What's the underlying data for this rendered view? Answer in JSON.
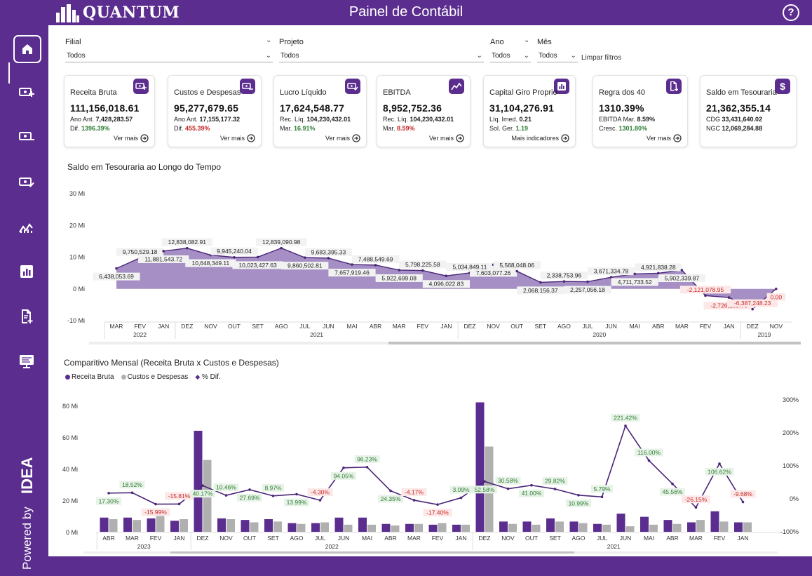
{
  "header": {
    "logo_text": "QUANTUM",
    "title": "Painel de Contábil",
    "help_icon": "question-icon"
  },
  "sidebar": {
    "items": [
      {
        "icon": "home-icon",
        "active": true
      },
      {
        "icon": "money-add-icon",
        "active": false
      },
      {
        "icon": "money-remove-icon",
        "active": false
      },
      {
        "icon": "money-check-icon",
        "active": false
      },
      {
        "icon": "trend-icon",
        "active": false
      },
      {
        "icon": "bar-chart-icon",
        "active": false
      },
      {
        "icon": "document-add-icon",
        "active": false
      },
      {
        "icon": "monitor-icon",
        "active": false
      }
    ],
    "powered_by": "Powered by",
    "brand": "IDEA"
  },
  "filters": {
    "filial_label": "Filial",
    "filial_value": "Todos",
    "projeto_label": "Projeto",
    "projeto_value": "Todos",
    "ano_label": "Ano",
    "ano_value": "Todos",
    "mes_label": "Mês",
    "mes_value": "Todos",
    "clear_label": "Limpar filtros"
  },
  "cards": [
    {
      "title": "Receita Bruta",
      "value": "111,156,018.61",
      "l1_label": "Ano Ant.",
      "l1_value": "7,428,283.57",
      "l2_label": "Dif.",
      "l2_value": "1396.39%",
      "l2_tone": "pos",
      "more": "Ver mais",
      "icon": "money-add-icon"
    },
    {
      "title": "Custos e Despesas",
      "value": "95,277,679.65",
      "l1_label": "Ano Ant.",
      "l1_value": "17,155,177.32",
      "l2_label": "Dif.",
      "l2_value": "455.39%",
      "l2_tone": "neg",
      "more": "Ver mais",
      "icon": "money-remove-icon"
    },
    {
      "title": "Lucro Líquido",
      "value": "17,624,548.77",
      "l1_label": "Rec. Líq.",
      "l1_value": "104,230,432.01",
      "l2_label": "Mar.",
      "l2_value": "16.91%",
      "l2_tone": "pos",
      "more": "Ver mais",
      "icon": "money-check-icon"
    },
    {
      "title": "EBITDA",
      "value": "8,952,752.36",
      "l1_label": "Rec. Líq.",
      "l1_value": "104,230,432.01",
      "l2_label": "Mar.",
      "l2_value": "8.59%",
      "l2_tone": "neg",
      "more": "Ver mais",
      "icon": "trend-icon"
    },
    {
      "title": "Capital Giro Proprio",
      "value": "31,104,276.91",
      "l1_label": "Líq. Imed.",
      "l1_value": "0.21",
      "l2_label": "Sol. Ger.",
      "l2_value": "1.19",
      "l2_tone": "pos",
      "more": "Mais indicadores",
      "icon": "bar-chart-icon"
    },
    {
      "title": "Regra dos 40",
      "value": "1310.39%",
      "l1_label": "EBITDA Mar.",
      "l1_value": "8.59%",
      "l2_label": "Cresc.",
      "l2_value": "1301.80%",
      "l2_tone": "pos",
      "more": "Ver mais",
      "icon": "document-add-icon"
    },
    {
      "title": "Saldo em Tesouraria",
      "value": "21,362,355.14",
      "l1_label": "CDG",
      "l1_value": "33,431,640.02",
      "l2_label": "NGC",
      "l2_value": "12,069,284.88",
      "l2_tone": "plain",
      "more": "",
      "icon": "dollar-icon"
    }
  ],
  "colors": {
    "purple": "#5b2d8e",
    "area": "#a58fc4",
    "gray": "#b0b0b0",
    "pos": "#2e7d32",
    "neg": "#c62828"
  },
  "chart_data": [
    {
      "type": "area",
      "title": "Saldo em Tesouraria ao Longo do Tempo",
      "y_ticks": [
        "30 Mi",
        "20 Mi",
        "10 Mi",
        "0 Mi",
        "-10 Mi"
      ],
      "ylim": [
        -10,
        30
      ],
      "y_unit": "Mi",
      "categories": [
        "MAR",
        "FEV",
        "JAN",
        "DEZ",
        "NOV",
        "OUT",
        "SET",
        "AGO",
        "JUL",
        "JUN",
        "MAI",
        "ABR",
        "MAR",
        "FEV",
        "JAN",
        "DEZ",
        "NOV",
        "OUT",
        "SET",
        "AGO",
        "JUL",
        "JUN",
        "MAI",
        "ABR",
        "MAR",
        "FEV",
        "JAN",
        "DEZ",
        "NOV"
      ],
      "year_groups": [
        {
          "label": "2022",
          "count": 3
        },
        {
          "label": "2021",
          "count": 12
        },
        {
          "label": "2020",
          "count": 12
        },
        {
          "label": "2019",
          "count": 2
        }
      ],
      "values": [
        6438053.69,
        9750529.18,
        11881543.72,
        12838082.91,
        10648349.11,
        9945240.04,
        10023427.63,
        12839090.98,
        9860502.81,
        9683395.33,
        7657919.46,
        7488549.69,
        5922699.08,
        5798225.58,
        4096022.83,
        5034849.11,
        7603077.26,
        5568048.06,
        2068156.37,
        2338753.96,
        2257056.18,
        3671334.78,
        4711733.52,
        4921838.28,
        5902339.87,
        -2121078.95,
        -2726159.76,
        -6387248.23,
        0.0
      ],
      "labels": [
        "6,438,053.69",
        "9,750,529.18",
        "11,881,543.72",
        "12,838,082.91",
        "10,648,349.11",
        "9,945,240.04",
        "10,023,427.63",
        "12,839,090.98",
        "9,860,502.81",
        "9,683,395.33",
        "7,657,919.46",
        "7,488,549.69",
        "5,922,699.08",
        "5,798,225.58",
        "4,096,022.83",
        "5,034,849.11",
        "7,603,077.26",
        "5,568,048.06",
        "2,068,156.37",
        "2,338,753.96",
        "2,257,056.18",
        "3,671,334.78",
        "4,711,733.52",
        "4,921,838.28",
        "5,902,339.87",
        "-2,121,078.95",
        "-2,726,159.76",
        "-6,387,248.23",
        "0.00"
      ]
    },
    {
      "type": "bar",
      "title": "Comparitivo Mensal (Receita Bruta x Custos e Despesas)",
      "legend": [
        "Receita Bruta",
        "Custos e Despesas",
        "% Dif."
      ],
      "y_ticks": [
        "80 Mi",
        "60 Mi",
        "40 Mi",
        "20 Mi",
        "0 Mi"
      ],
      "ylim": [
        0,
        80
      ],
      "y2_ticks": [
        "300%",
        "200%",
        "100%",
        "0%",
        "-100%"
      ],
      "y2lim": [
        -100,
        300
      ],
      "categories": [
        "ABR",
        "MAR",
        "FEV",
        "JAN",
        "DEZ",
        "NOV",
        "OUT",
        "SET",
        "AGO",
        "JUL",
        "JUN",
        "MAI",
        "ABR",
        "MAR",
        "FEV",
        "JAN",
        "DEZ",
        "NOV",
        "OUT",
        "SET",
        "AGO",
        "JUL",
        "JUN",
        "MAI",
        "ABR",
        "MAR",
        "FEV",
        "JAN"
      ],
      "year_groups": [
        {
          "label": "2023",
          "count": 4
        },
        {
          "label": "2022",
          "count": 12
        },
        {
          "label": "2021",
          "count": 12
        }
      ],
      "series": [
        {
          "name": "Receita Bruta",
          "values": [
            9,
            9,
            8.5,
            7,
            64,
            8.5,
            7.5,
            8,
            5.5,
            5.5,
            9,
            9,
            5,
            5,
            4.5,
            4.5,
            82,
            6.5,
            6.5,
            8.5,
            6.5,
            5,
            11.5,
            9.5,
            7.5,
            6,
            13,
            6
          ]
        },
        {
          "name": "Custos e Despesas",
          "values": [
            8,
            7.5,
            10,
            8,
            45.5,
            8,
            6,
            6.5,
            5,
            6,
            4.5,
            4.5,
            4,
            5,
            5.5,
            4.5,
            54,
            5,
            4.5,
            6.5,
            5.5,
            4.5,
            3.5,
            4.5,
            5,
            7.5,
            6.5,
            6
          ]
        },
        {
          "name": "% Dif.",
          "values": [
            17.3,
            18.52,
            -15.99,
            -15.81,
            40.17,
            10.46,
            27.69,
            8.97,
            13.99,
            -4.3,
            94.05,
            96.23,
            24.35,
            -4.17,
            -17.4,
            3.09,
            52.58,
            30.58,
            41.0,
            29.82,
            10.99,
            5.79,
            221.42,
            116.0,
            45.56,
            -26.15,
            106.62,
            -9.68
          ]
        }
      ],
      "dif_labels": [
        "17.30%",
        "18.52%",
        "-15.99%",
        "-15.81%",
        "40.17%",
        "10.46%",
        "27.69%",
        "8.97%",
        "13.99%",
        "-4.30%",
        "94.05%",
        "96.23%",
        "24.35%",
        "-4.17%",
        "-17.40%",
        "3.09%",
        "52.58%",
        "30.58%",
        "41.00%",
        "29.82%",
        "10.99%",
        "5.79%",
        "221.42%",
        "116.00%",
        "45.56%",
        "-26.15%",
        "106.62%",
        "-9.68%"
      ]
    }
  ]
}
